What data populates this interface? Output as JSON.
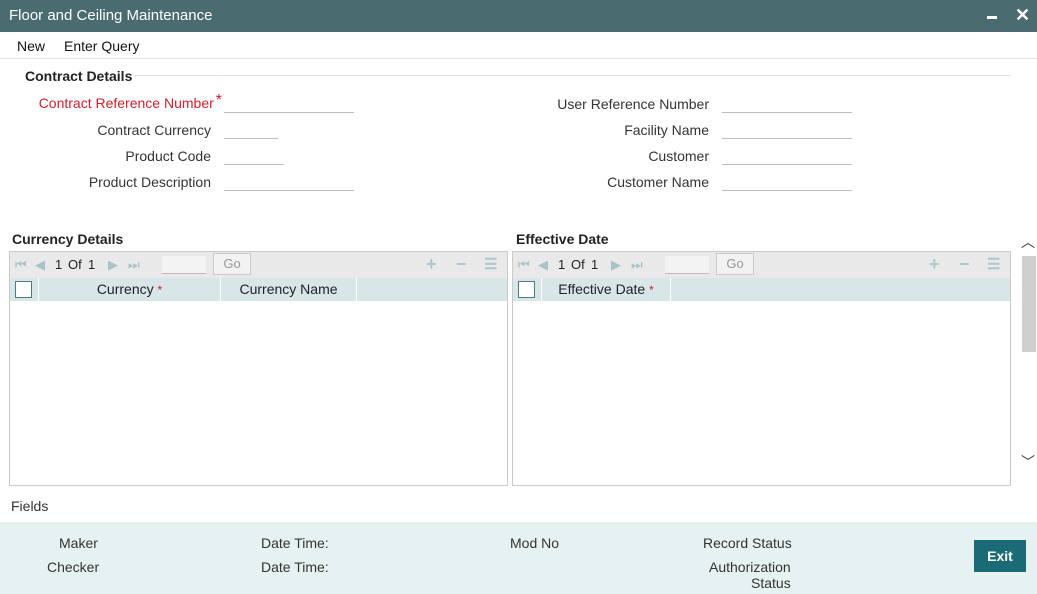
{
  "window": {
    "title": "Floor and Ceiling Maintenance"
  },
  "menu": {
    "new": "New",
    "enter_query": "Enter Query"
  },
  "contract": {
    "section_title": "Contract Details",
    "contract_ref_label": "Contract Reference Number",
    "contract_ref_required": "*",
    "contract_currency_label": "Contract Currency",
    "product_code_label": "Product Code",
    "product_description_label": "Product Description",
    "user_ref_label": "User Reference Number",
    "facility_name_label": "Facility Name",
    "customer_label": "Customer",
    "customer_name_label": "Customer Name",
    "contract_ref_value": "",
    "contract_currency_value": "",
    "product_code_value": "",
    "product_description_value": "",
    "user_ref_value": "",
    "facility_name_value": "",
    "customer_value": "",
    "customer_name_value": ""
  },
  "currency_details": {
    "title": "Currency Details",
    "pager": {
      "current": "1",
      "of_label": "Of",
      "total": "1",
      "go": "Go"
    },
    "columns": [
      {
        "label": "Currency",
        "required": "*"
      },
      {
        "label": "Currency Name"
      }
    ]
  },
  "effective_date": {
    "title": "Effective Date",
    "pager": {
      "current": "1",
      "of_label": "Of",
      "total": "1",
      "go": "Go"
    },
    "columns": [
      {
        "label": "Effective Date",
        "required": "*"
      }
    ]
  },
  "fields_label": "Fields",
  "footer": {
    "maker": "Maker",
    "checker": "Checker",
    "date_time_1": "Date Time:",
    "date_time_2": "Date Time:",
    "mod_no": "Mod No",
    "record_status": "Record Status",
    "authorization_status_1": "Authorization",
    "authorization_status_2": "Status",
    "exit": "Exit"
  },
  "colors": {
    "titlebar": "#4a6b6f",
    "required": "#d0202b",
    "exit_button": "#1b6b77",
    "footer_bg": "#e6f1f2",
    "grid_header": "#d8e6e8"
  },
  "icons": {
    "minimize": "minimize-icon",
    "close": "close-icon",
    "first": "first-page-icon",
    "prev": "prev-page-icon",
    "next": "next-page-icon",
    "last": "last-page-icon",
    "add": "plus-icon",
    "delete": "minus-icon",
    "view": "list-icon"
  }
}
